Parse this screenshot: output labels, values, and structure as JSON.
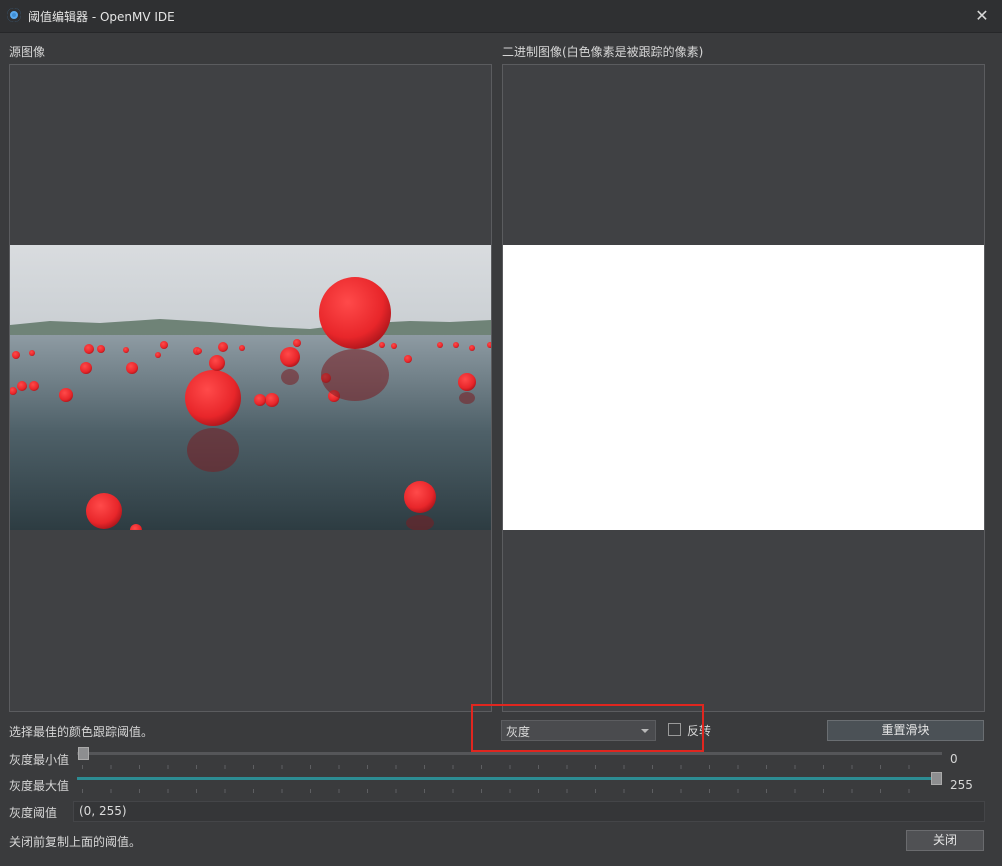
{
  "window": {
    "title": "阈值编辑器 - OpenMV IDE",
    "icon": "openmv-app-icon",
    "close_icon": "close-icon"
  },
  "panes": {
    "source_label": "源图像",
    "binary_label": "二进制图像(白色像素是被跟踪的像素)"
  },
  "controls": {
    "status_text": "选择最佳的颜色跟踪阈值。",
    "mode_value": "灰度",
    "invert_label": "反转",
    "invert_checked": false,
    "reset_button": "重置滑块"
  },
  "sliders": {
    "min": {
      "label": "灰度最小值",
      "value": "0"
    },
    "max": {
      "label": "灰度最大值",
      "value": "255"
    }
  },
  "threshold": {
    "label": "灰度阈值",
    "value": "(0, 255)"
  },
  "footer": {
    "hint": "关闭前复制上面的阈值。",
    "close_button": "关闭"
  },
  "colors": {
    "highlight": "#e0261f",
    "slider_fill": "#2c8c93",
    "ball": "#e8262a"
  }
}
